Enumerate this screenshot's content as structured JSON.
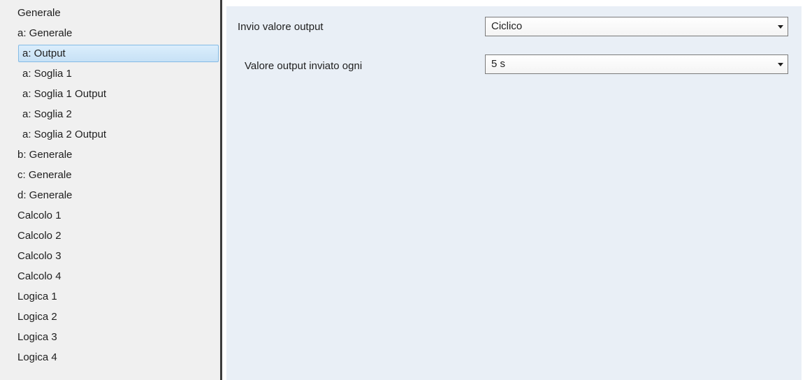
{
  "sidebar": {
    "items": [
      {
        "label": "Generale",
        "level": 0,
        "selected": false
      },
      {
        "label": "a: Generale",
        "level": 0,
        "selected": false
      },
      {
        "label": "a: Output",
        "level": 1,
        "selected": true
      },
      {
        "label": "a: Soglia 1",
        "level": 1,
        "selected": false
      },
      {
        "label": "a: Soglia 1 Output",
        "level": 1,
        "selected": false
      },
      {
        "label": "a: Soglia 2",
        "level": 1,
        "selected": false
      },
      {
        "label": "a: Soglia 2 Output",
        "level": 1,
        "selected": false
      },
      {
        "label": "b: Generale",
        "level": 0,
        "selected": false
      },
      {
        "label": "c: Generale",
        "level": 0,
        "selected": false
      },
      {
        "label": "d: Generale",
        "level": 0,
        "selected": false
      },
      {
        "label": "Calcolo 1",
        "level": 0,
        "selected": false
      },
      {
        "label": "Calcolo 2",
        "level": 0,
        "selected": false
      },
      {
        "label": "Calcolo 3",
        "level": 0,
        "selected": false
      },
      {
        "label": "Calcolo 4",
        "level": 0,
        "selected": false
      },
      {
        "label": "Logica 1",
        "level": 0,
        "selected": false
      },
      {
        "label": "Logica 2",
        "level": 0,
        "selected": false
      },
      {
        "label": "Logica 3",
        "level": 0,
        "selected": false
      },
      {
        "label": "Logica 4",
        "level": 0,
        "selected": false
      }
    ]
  },
  "params": [
    {
      "label": "Invio valore output",
      "value": "Ciclico",
      "icon": "chevron-down-icon"
    },
    {
      "label": "Valore output inviato ogni",
      "value": "5 s",
      "icon": "chevron-down-icon"
    }
  ],
  "colors": {
    "sidebar_bg": "#f0f0f0",
    "panel_bg": "#e9eff6",
    "selection_fill": "#cde6f7",
    "selection_border": "#84bbe5",
    "splitter": "#3c3c3c"
  }
}
